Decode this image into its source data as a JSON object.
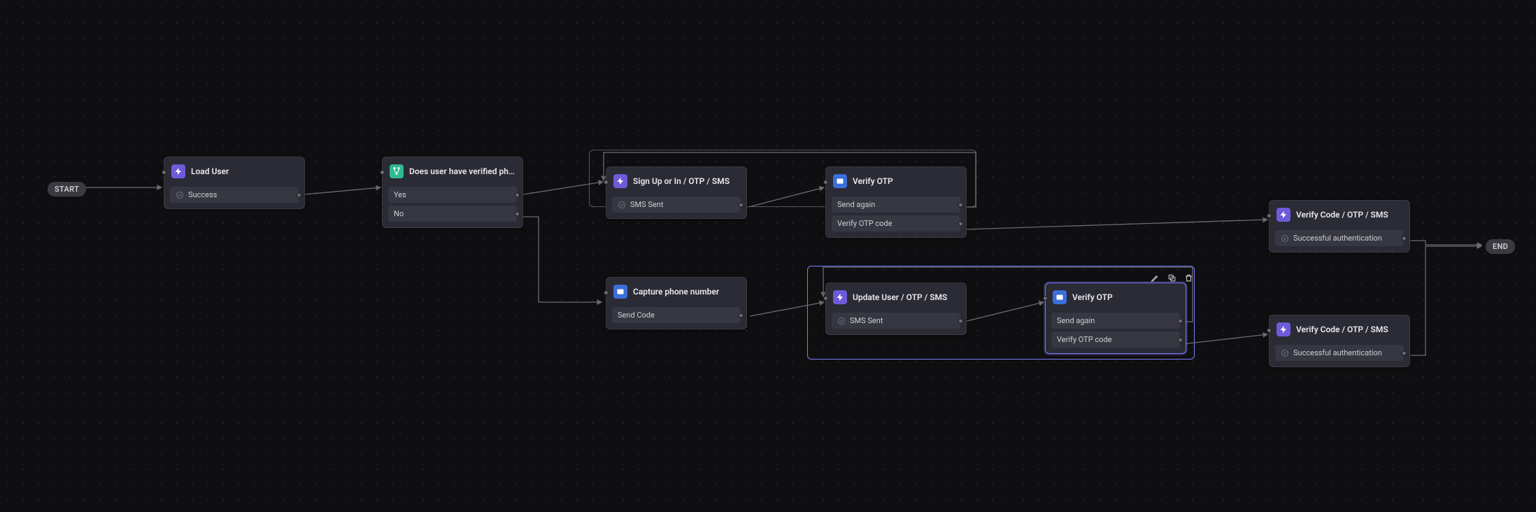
{
  "pills": {
    "start": "START",
    "end": "END"
  },
  "nodes": {
    "loadUser": {
      "title": "Load User",
      "outputs": [
        "Success"
      ]
    },
    "condition": {
      "title": "Does user have verified phone…",
      "outputs": [
        "Yes",
        "No"
      ]
    },
    "signup": {
      "title": "Sign Up or In / OTP / SMS",
      "outputs": [
        "SMS Sent"
      ]
    },
    "verify1": {
      "title": "Verify OTP",
      "outputs": [
        "Send again",
        "Verify OTP code"
      ]
    },
    "capture": {
      "title": "Capture phone number",
      "outputs": [
        "Send Code"
      ]
    },
    "update": {
      "title": "Update User / OTP / SMS",
      "outputs": [
        "SMS Sent"
      ]
    },
    "verify2": {
      "title": "Verify OTP",
      "outputs": [
        "Send again",
        "Verify OTP code"
      ]
    },
    "vcode1": {
      "title": "Verify Code / OTP / SMS",
      "outputs": [
        "Successful authentication"
      ]
    },
    "vcode2": {
      "title": "Verify Code / OTP / SMS",
      "outputs": [
        "Successful authentication"
      ]
    }
  },
  "tools": {
    "edit": "edit",
    "copy": "copy",
    "delete": "delete"
  }
}
